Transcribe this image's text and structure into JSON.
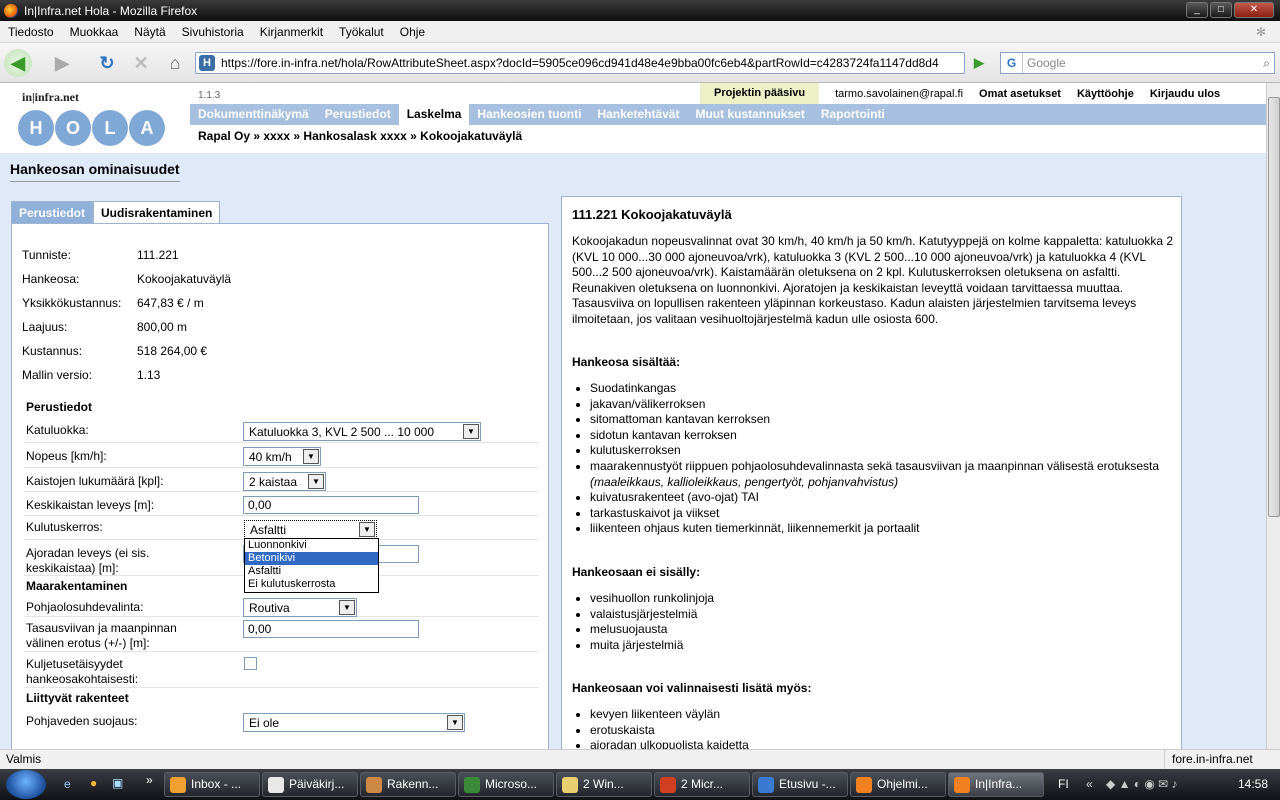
{
  "window": {
    "title": "In|Infra.net Hola - Mozilla Firefox"
  },
  "menu": [
    "Tiedosto",
    "Muokkaa",
    "Näytä",
    "Sivuhistoria",
    "Kirjanmerkit",
    "Työkalut",
    "Ohje"
  ],
  "nav": {
    "url": "https://fore.in-infra.net/hola/RowAttributeSheet.aspx?docId=5905ce096cd941d48e4e9bba00fc6eb4&partRowId=c4283724fa1147dd8d4",
    "search_placeholder": "Google"
  },
  "header": {
    "brand": "in|infra.net",
    "version": "1.1.3",
    "logo_letters": [
      "H",
      "O",
      "L",
      "A"
    ],
    "top_links": {
      "project_home": "Projektin pääsivu",
      "user": "tarmo.savolainen@rapal.fi",
      "settings": "Omat asetukset",
      "help": "Käyttöohje",
      "logout": "Kirjaudu ulos"
    },
    "main_nav": [
      "Dokumenttinäkymä",
      "Perustiedot",
      "Laskelma",
      "Hankeosien tuonti",
      "Hanketehtävät",
      "Muut kustannukset",
      "Raportointi"
    ],
    "active_nav": "Laskelma",
    "breadcrumb": "Rapal Oy » xxxx » Hankosalask xxxx » Kokoojakatuväylä"
  },
  "page_title": "Hankeosan ominaisuudet",
  "tabs": [
    "Perustiedot",
    "Uudisrakentaminen"
  ],
  "info": [
    {
      "label": "Tunniste:",
      "value": "111.221"
    },
    {
      "label": "Hankeosa:",
      "value": "Kokoojakatuväylä"
    },
    {
      "label": "Yksikkökustannus:",
      "value": "647,83 € / m"
    },
    {
      "label": "Laajuus:",
      "value": "800,00 m"
    },
    {
      "label": "Kustannus:",
      "value": "518 264,00 €"
    },
    {
      "label": "Mallin versio:",
      "value": "1.13"
    }
  ],
  "form": {
    "sec_perustiedot": "Perustiedot",
    "katuluokka_label": "Katuluokka:",
    "katuluokka_value": "Katuluokka 3, KVL 2 500 ... 10 000",
    "nopeus_label": "Nopeus [km/h]:",
    "nopeus_value": "40 km/h",
    "kaistat_label": "Kaistojen lukumäärä [kpl]:",
    "kaistat_value": "2 kaistaa",
    "keskikaista_label": "Keskikaistan leveys [m]:",
    "keskikaista_value": "0,00",
    "kulutus_label": "Kulutuskerros:",
    "kulutus_value": "Asfaltti",
    "kulutus_options": [
      "Luonnonkivi",
      "Betonikivi",
      "Asfaltti",
      "Ei kulutuskerrosta"
    ],
    "ajorata_label1": "Ajoradan leveys (ei sis.",
    "ajorata_label2": "keskikaistaa) [m]:",
    "sec_maarakentaminen": "Maarakentaminen",
    "pohja_label": "Pohjaolosuhdevalinta:",
    "pohja_value": "Routiva",
    "tasaus_label1": "Tasausviivan ja maanpinnan",
    "tasaus_label2": "välinen erotus (+/-) [m]:",
    "tasaus_value": "0,00",
    "kuljetus_label1": "Kuljetusetäisyydet",
    "kuljetus_label2": "hankeosakohtaisesti:",
    "sec_liittyvat": "Liittyvät rakenteet",
    "pohjavesi_label": "Pohjaveden suojaus:",
    "pohjavesi_value": "Ei ole"
  },
  "description": {
    "title": "111.221 Kokoojakatuväylä",
    "text": "Kokoojakadun nopeusvalinnat ovat 30 km/h, 40 km/h ja 50 km/h. Katutyyppejä on kolme kappaletta: katuluokka 2 (KVL 10 000...30 000 ajoneuvoa/vrk), katuluokka 3 (KVL 2 500...10 000 ajoneuvoa/vrk) ja katuluokka 4 (KVL 500...2 500 ajoneuvoa/vrk). Kaistamäärän oletuksena on 2 kpl. Kulutuskerroksen oletuksena on asfaltti. Reunakiven oletuksena on luonnonkivi. Ajoratojen ja keskikaistan leveyttä voidaan tarvittaessa muuttaa. Tasausviiva on lopullisen rakenteen yläpinnan korkeustaso. Kadun alaisten järjestelmien tarvitsema leveys ilmoitetaan, jos valitaan vesihuoltojärjestelmä kadun ulle osiosta 600.",
    "includes_title": "Hankeosa sisältää:",
    "includes": [
      "Suodatinkangas",
      "jakavan/välikerroksen",
      "sitomattoman kantavan kerroksen",
      "sidotun kantavan kerroksen",
      "kulutuskerroksen",
      "maarakennustyöt riippuen pohjaolosuhdevalinnasta sekä tasausviivan ja maanpinnan välisestä erotuksesta (maaleikkaus, kallioleikkaus, pengertyöt, pohjanvahvistus)",
      "kuivatusrakenteet (avo-ojat) TAI",
      "tarkastuskaivot ja viikset",
      "liikenteen ohjaus kuten tiemerkinnät, liikennemerkit ja portaalit"
    ],
    "excludes_title": "Hankeosaan ei sisälly:",
    "excludes": [
      "vesihuollon runkolinjoja",
      "valaistusjärjestelmiä",
      "melusuojausta",
      "muita järjestelmiä"
    ],
    "optional_title": "Hankeosaan voi valinnaisesti lisätä myös:",
    "optional": [
      "kevyen liikenteen väylän",
      "erotuskaista",
      "ajoradan ulkopuolista kaidetta"
    ]
  },
  "status": {
    "left": "Valmis",
    "right": "fore.in-infra.net"
  },
  "taskbar": {
    "items": [
      "Inbox - ...",
      "Päiväkirj...",
      "Rakenn...",
      "Microso...",
      "2 Win...",
      "2 Micr...",
      "Etusivu -...",
      "Ohjelmi...",
      "In|Infra..."
    ],
    "lang": "FI",
    "clock": "14:58"
  }
}
